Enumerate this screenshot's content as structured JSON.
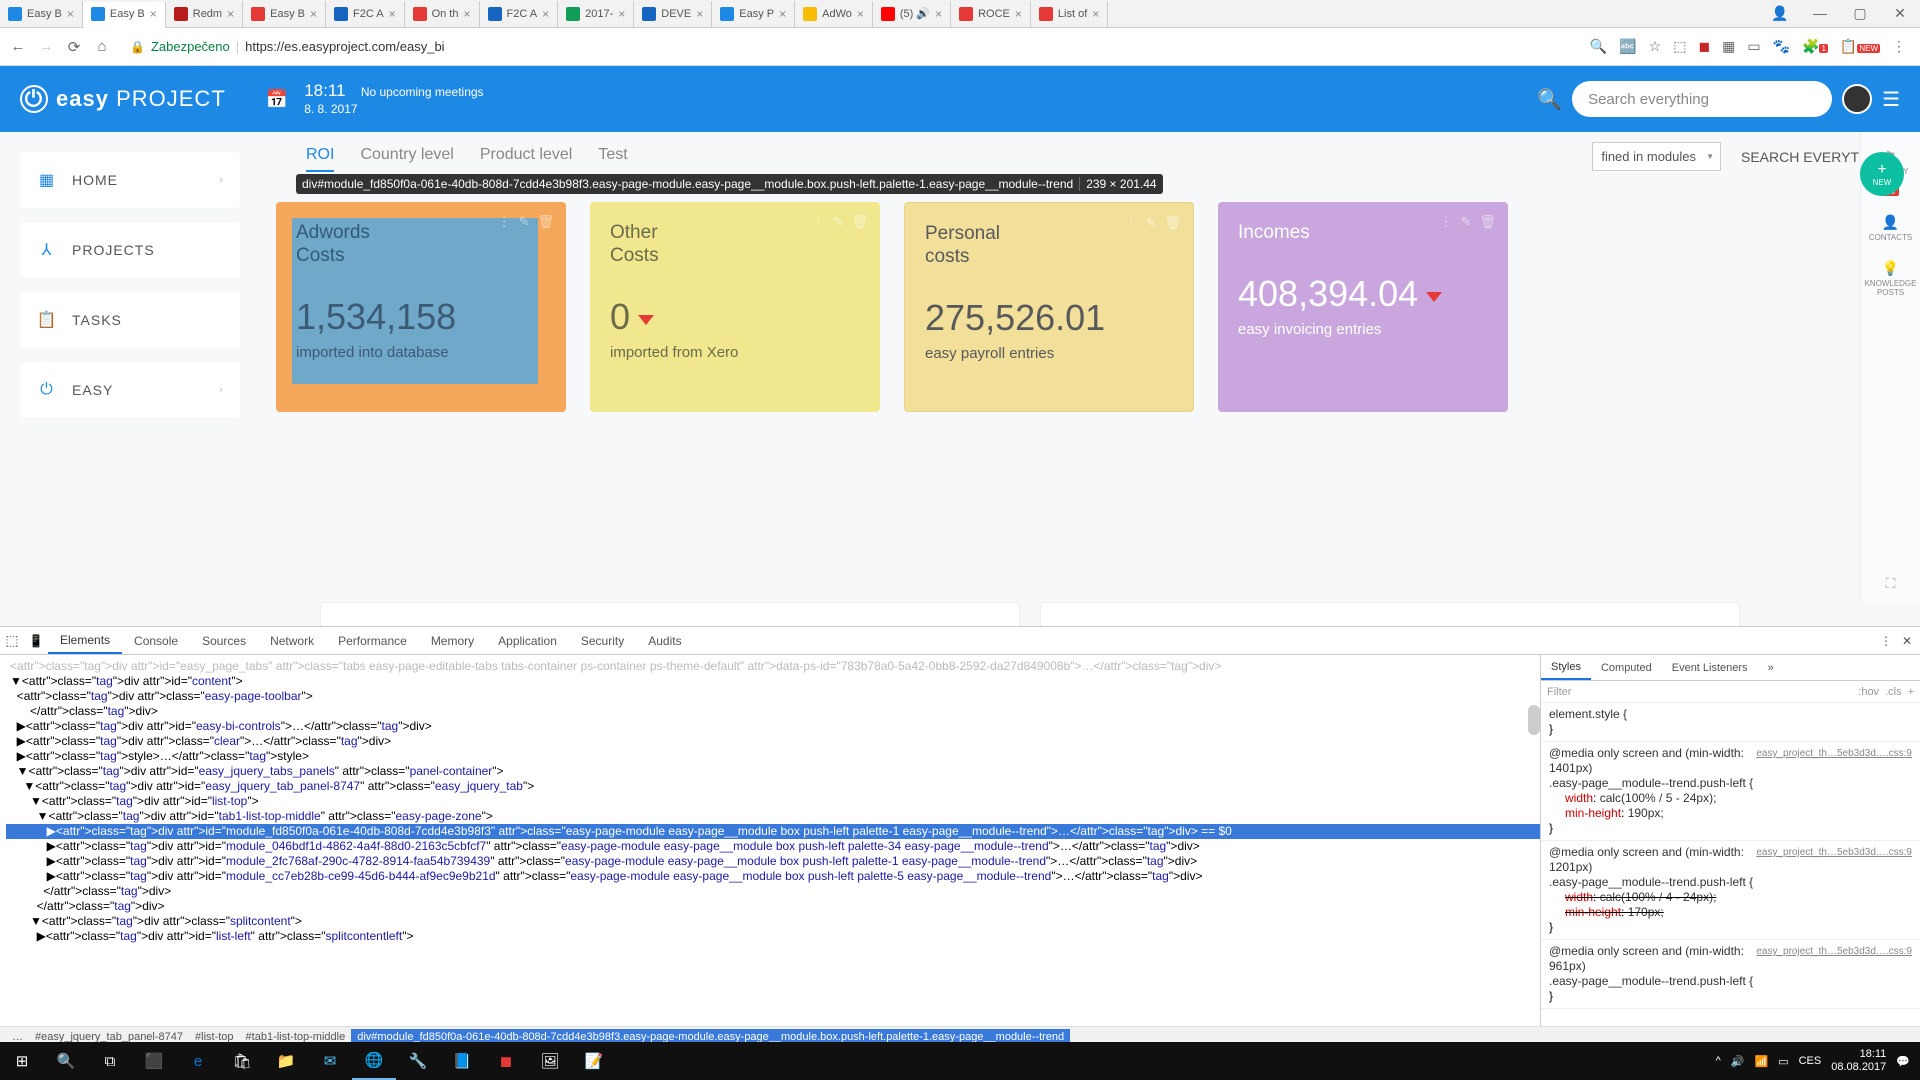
{
  "browser": {
    "tabs": [
      {
        "label": "Easy B"
      },
      {
        "label": "Easy B"
      },
      {
        "label": "Redm"
      },
      {
        "label": "Easy B"
      },
      {
        "label": "F2C A"
      },
      {
        "label": "On th"
      },
      {
        "label": "F2C A"
      },
      {
        "label": "2017-"
      },
      {
        "label": "DEVE"
      },
      {
        "label": "Easy P"
      },
      {
        "label": "AdWo"
      },
      {
        "label": "(5) 🔊"
      },
      {
        "label": "ROCE"
      },
      {
        "label": "List of"
      }
    ],
    "secure_label": "Zabezpečeno",
    "url": "https://es.easyproject.com/easy_bi"
  },
  "header": {
    "brand_bold": "easy",
    "brand_thin": "PROJECT",
    "time": "18:11",
    "date": "8. 8. 2017",
    "meetings": "No upcoming meetings",
    "search_placeholder": "Search everything"
  },
  "sidebar": {
    "items": [
      "HOME",
      "PROJECTS",
      "TASKS",
      "EASY"
    ]
  },
  "fab": {
    "label": "NEW"
  },
  "tabs": {
    "items": [
      "ROI",
      "Country level",
      "Product level",
      "Test"
    ],
    "dropdown": "fined in modules",
    "search_label": "SEARCH EVERYTHING"
  },
  "inspector_tip": {
    "selector": "div#module_fd850f0a-061e-40db-808d-7cdd4e3b98f3.easy-page-module.easy-page__module.box.push-left.palette-1.easy-page__module--trend",
    "dims": "239 × 201.44"
  },
  "cards": [
    {
      "title1": "Adwords",
      "title2": "Costs",
      "value": "1,534,158",
      "sub": "imported into database"
    },
    {
      "title1": "Other",
      "title2": "Costs",
      "value": "0",
      "sub": "imported from Xero"
    },
    {
      "title1": "Personal",
      "title2": "costs",
      "value": "275,526.01",
      "sub": "easy payroll entries"
    },
    {
      "title1": "Incomes",
      "title2": "",
      "value": "408,394.04",
      "sub": "easy invoicing entries"
    }
  ],
  "right_rail": {
    "activity": "ACTIVITY FEED",
    "badge": "45",
    "contacts": "CONTACTS",
    "knowledge": "KNOWLEDGE POSTS"
  },
  "devtools": {
    "tabs": [
      "Elements",
      "Console",
      "Sources",
      "Network",
      "Performance",
      "Memory",
      "Application",
      "Security",
      "Audits"
    ],
    "styles_tabs": [
      "Styles",
      "Computed",
      "Event Listeners"
    ],
    "filter": "Filter",
    "hov": ":hov",
    "cls": ".cls",
    "elements": [
      "<div id=\"easy_page_tabs\" class=\"tabs easy-page-editable-tabs tabs-container ps-container ps-theme-default\" data-ps-id=\"783b78a0-5a42-0bb8-2592-da27d849008b\">…</div>",
      "▼<div id=\"content\">",
      "  <div class=\"easy-page-toolbar\">",
      "",
      "      </div>",
      "  ▶<div id=\"easy-bi-controls\">…</div>",
      "  ▶<div class=\"clear\">…</div>",
      "  ▶<style>…</style>",
      "  ▼<div id=\"easy_jquery_tabs_panels\" class=\"panel-container\">",
      "    ▼<div id=\"easy_jquery_tab_panel-8747\" class=\"easy_jquery_tab\">",
      "      ▼<div id=\"list-top\">",
      "        ▼<div id=\"tab1-list-top-middle\" class=\"easy-page-zone\">",
      "           ▶<div id=\"module_fd850f0a-061e-40db-808d-7cdd4e3b98f3\" class=\"easy-page-module easy-page__module box push-left palette-1 easy-page__module--trend\">…</div> == $0",
      "           ▶<div id=\"module_046bdf1d-4862-4a4f-88d0-2163c5cbfcf7\" class=\"easy-page-module easy-page__module box push-left palette-34 easy-page__module--trend\">…</div>",
      "           ▶<div id=\"module_2fc768af-290c-4782-8914-faa54b739439\" class=\"easy-page-module easy-page__module box push-left palette-1 easy-page__module--trend\">…</div>",
      "           ▶<div id=\"module_cc7eb28b-ce99-45d6-b444-af9ec9e9b21d\" class=\"easy-page-module easy-page__module box push-left palette-5 easy-page__module--trend\">…</div>",
      "          </div>",
      "        </div>",
      "      ▼<div class=\"splitcontent\">",
      "        ▶<div id=\"list-left\" class=\"splitcontentleft\">"
    ],
    "selected_index": 12,
    "breadcrumb": [
      "…",
      "#easy_jquery_tab_panel-8747",
      "#list-top",
      "#tab1-list-top-middle",
      "div#module_fd850f0a-061e-40db-808d-7cdd4e3b98f3.easy-page-module.easy-page__module.box.push-left.palette-1.easy-page__module--trend"
    ],
    "css": [
      {
        "sel": "element.style {",
        "src": "",
        "props": []
      },
      {
        "sel": "@media only screen and (min-width: 1401px)\n.easy-page__module--trend.push-left {",
        "src": "easy_project_th…5eb3d3d….css:9",
        "props": [
          {
            "p": "width",
            "v": "calc(100% / 5 - 24px);"
          },
          {
            "p": "min-height",
            "v": "190px;"
          }
        ]
      },
      {
        "sel": "@media only screen and (min-width: 1201px)\n.easy-page__module--trend.push-left {",
        "src": "easy_project_th…5eb3d3d….css:9",
        "props": [
          {
            "p": "width",
            "v": "calc(100% / 4 - 24px);",
            "strike": true
          },
          {
            "p": "min-height",
            "v": "170px;",
            "strike": true
          }
        ]
      },
      {
        "sel": "@media only screen and (min-width: 961px)\n.easy-page__module--trend.push-left {",
        "src": "easy_project_th…5eb3d3d….css:9",
        "props": []
      }
    ]
  },
  "taskbar": {
    "lang": "CES",
    "time": "18:11",
    "date": "08.08.2017"
  }
}
